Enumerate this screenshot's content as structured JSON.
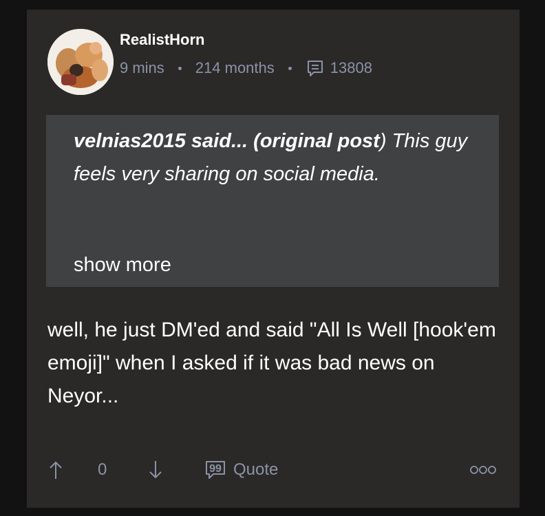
{
  "post": {
    "username": "RealistHorn",
    "time_ago": "9 mins",
    "member_age": "214 months",
    "comment_count": "13808",
    "avatar_icon": "user-avatar",
    "quote": {
      "author_line": "velnias2015 said... (original post",
      "close_paren": ")",
      "text": " This guy feels very sharing on social media.",
      "show_more": "show more"
    },
    "body": "well, he just DM'ed and said \"All Is Well [hook'em emoji]\" when I asked if it was bad news on Neyor...",
    "actions": {
      "upvote_icon": "arrow-up-icon",
      "vote_count": "0",
      "downvote_icon": "arrow-down-icon",
      "quote_label": "Quote",
      "more_icon": "more-options-icon"
    }
  },
  "colors": {
    "background": "#121212",
    "card": "#2a2928",
    "quote_box": "#404142",
    "muted": "#8c93a6",
    "text": "#ffffff"
  }
}
